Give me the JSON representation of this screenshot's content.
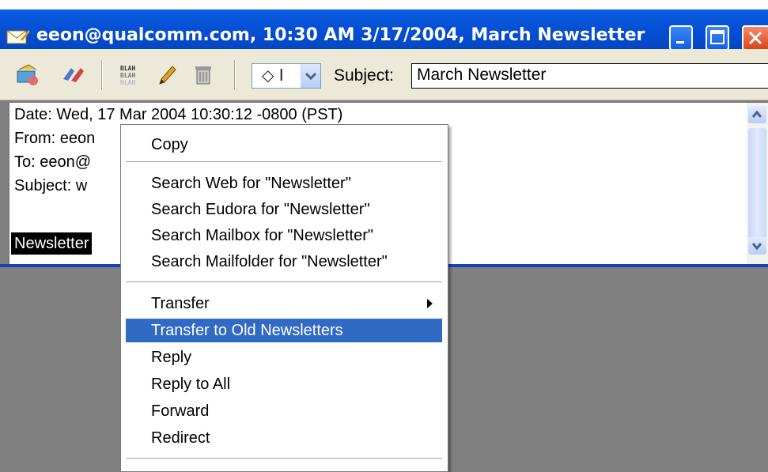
{
  "window": {
    "title": "eeon@qualcomm.com, 10:30 AM 3/17/2004, March Newsletter"
  },
  "toolbar": {
    "dropdown_value": "◇ I",
    "subject_label": "Subject:",
    "subject_value": "March Newsletter"
  },
  "message": {
    "lines": [
      "Date: Wed, 17 Mar 2004 10:30:12 -0800 (PST)",
      "From: eeon",
      "To: eeon@",
      "Subject: w"
    ],
    "selected_word": "Newsletter"
  },
  "context_menu": {
    "items": [
      "Copy",
      "Search Web for \"Newsletter\"",
      "Search Eudora for \"Newsletter\"",
      "Search Mailbox for \"Newsletter\"",
      "Search Mailfolder for \"Newsletter\"",
      "Transfer",
      "Transfer to Old Newsletters",
      "Reply",
      "Reply to All",
      "Forward",
      "Redirect"
    ],
    "highlighted": "Transfer to Old Newsletters"
  },
  "colors": {
    "titlebar": "#0650d6",
    "menu_highlight": "#316ac5"
  }
}
